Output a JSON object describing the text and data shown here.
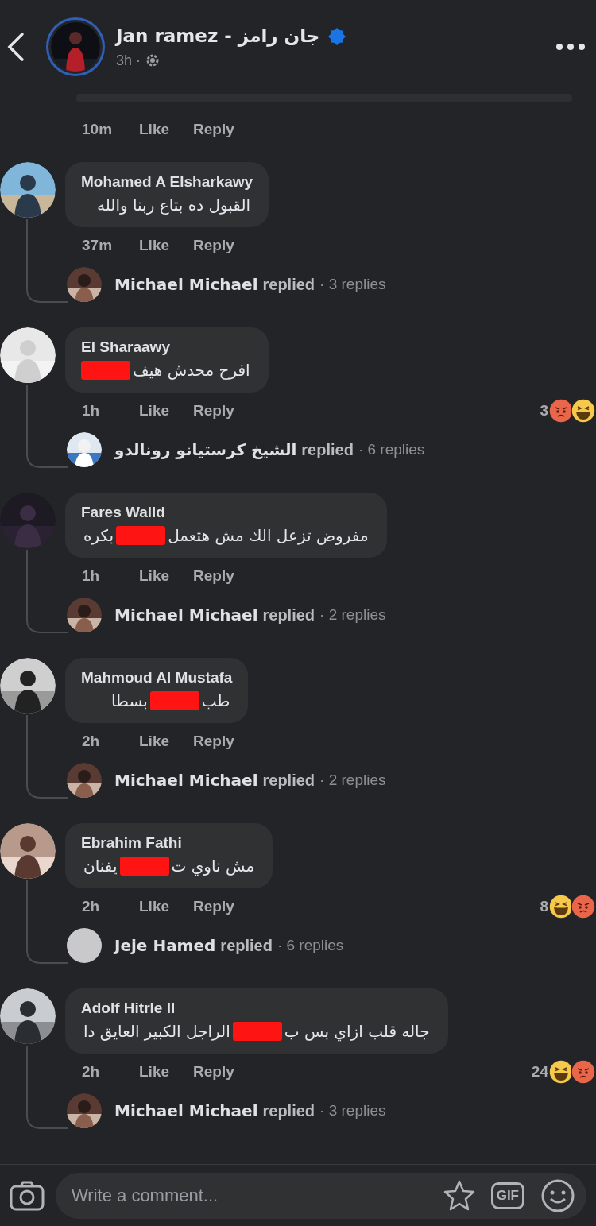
{
  "header": {
    "author": "Jan ramez - جان رامز",
    "verified": true,
    "time": "3h ·"
  },
  "previous_comment": {
    "time": "10m",
    "like": "Like",
    "reply": "Reply"
  },
  "comments": [
    {
      "name": "Mohamed A Elsharkawy",
      "text": [
        {
          "kind": "text",
          "value": "القبول ده بتاع ربنا والله"
        }
      ],
      "time": "37m",
      "like": "Like",
      "reply": "Reply",
      "replies": {
        "name": "Michael Michael",
        "verb": "replied",
        "count": "· 3 replies"
      }
    },
    {
      "name": "El Sharaawy",
      "text": [
        {
          "kind": "text",
          "value": "افرح محدش هيف"
        },
        {
          "kind": "redaction"
        }
      ],
      "time": "1h",
      "like": "Like",
      "reply": "Reply",
      "reactions": {
        "count": "3",
        "icons": [
          {
            "kind": "angry"
          },
          {
            "kind": "haha"
          }
        ]
      },
      "replies": {
        "name": "الشيخ كرستيانو رونالدو",
        "verb": "replied",
        "count": "· 6 replies"
      }
    },
    {
      "name": "Fares Walid",
      "text": [
        {
          "kind": "text",
          "value": "مفروض تزعل الك مش هتعمل"
        },
        {
          "kind": "redaction"
        },
        {
          "kind": "text",
          "value": "بكره"
        }
      ],
      "time": "1h",
      "like": "Like",
      "reply": "Reply",
      "replies": {
        "name": "Michael Michael",
        "verb": "replied",
        "count": "· 2 replies"
      }
    },
    {
      "name": "Mahmoud Al Mustafa",
      "text": [
        {
          "kind": "text",
          "value": "طب"
        },
        {
          "kind": "redaction"
        },
        {
          "kind": "text",
          "value": "بسطا"
        }
      ],
      "time": "2h",
      "like": "Like",
      "reply": "Reply",
      "replies": {
        "name": "Michael Michael",
        "verb": "replied",
        "count": "· 2 replies"
      }
    },
    {
      "name": "Ebrahim Fathi",
      "text": [
        {
          "kind": "text",
          "value": "مش ناوي ت"
        },
        {
          "kind": "redaction"
        },
        {
          "kind": "text",
          "value": "يفنان"
        }
      ],
      "time": "2h",
      "like": "Like",
      "reply": "Reply",
      "reactions": {
        "count": "8",
        "icons": [
          {
            "kind": "haha"
          },
          {
            "kind": "angry"
          }
        ]
      },
      "replies": {
        "kind": "blank",
        "name": "Jeje Hamed",
        "verb": "replied",
        "count": "· 6 replies"
      }
    },
    {
      "name": "Adolf Hitrle II",
      "text": [
        {
          "kind": "text",
          "value": "جاله قلب ازاي بس ب"
        },
        {
          "kind": "redaction"
        },
        {
          "kind": "text",
          "value": "الراجل الكبير العايق دا"
        }
      ],
      "time": "2h",
      "like": "Like",
      "reply": "Reply",
      "reactions": {
        "count": "24",
        "icons": [
          {
            "kind": "haha"
          },
          {
            "kind": "angry"
          }
        ]
      },
      "replies": {
        "name": "Michael Michael",
        "verb": "replied",
        "count": "· 3 replies"
      }
    }
  ],
  "composer": {
    "placeholder": "Write a comment...",
    "gif_label": "GIF"
  }
}
